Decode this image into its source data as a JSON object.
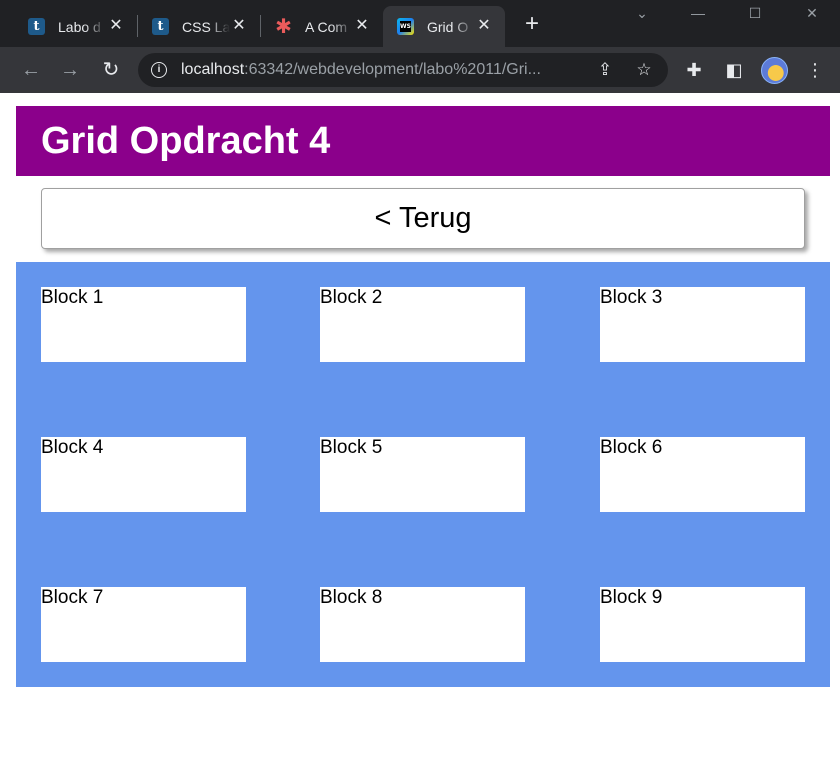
{
  "browser": {
    "tabs": [
      {
        "label": "Labo d",
        "favicon": "tumblr-icon",
        "active": false
      },
      {
        "label": "CSS La",
        "favicon": "tumblr-icon",
        "active": false
      },
      {
        "label": "A Com",
        "favicon": "asterisk-icon",
        "active": false
      },
      {
        "label": "Grid O",
        "favicon": "webstorm-icon",
        "active": true
      }
    ],
    "webstorm_badge": "WS",
    "address": {
      "host": "localhost",
      "rest": ":63342/webdevelopment/labo%2011/Gri..."
    }
  },
  "page": {
    "title": "Grid Opdracht 4",
    "back_label": "< Terug",
    "blocks": [
      "Block 1",
      "Block 2",
      "Block 3",
      "Block 4",
      "Block 5",
      "Block 6",
      "Block 7",
      "Block 8",
      "Block 9"
    ],
    "colors": {
      "header": "#8b008b",
      "grid_background": "#6495ed",
      "block": "#ffffff"
    }
  }
}
